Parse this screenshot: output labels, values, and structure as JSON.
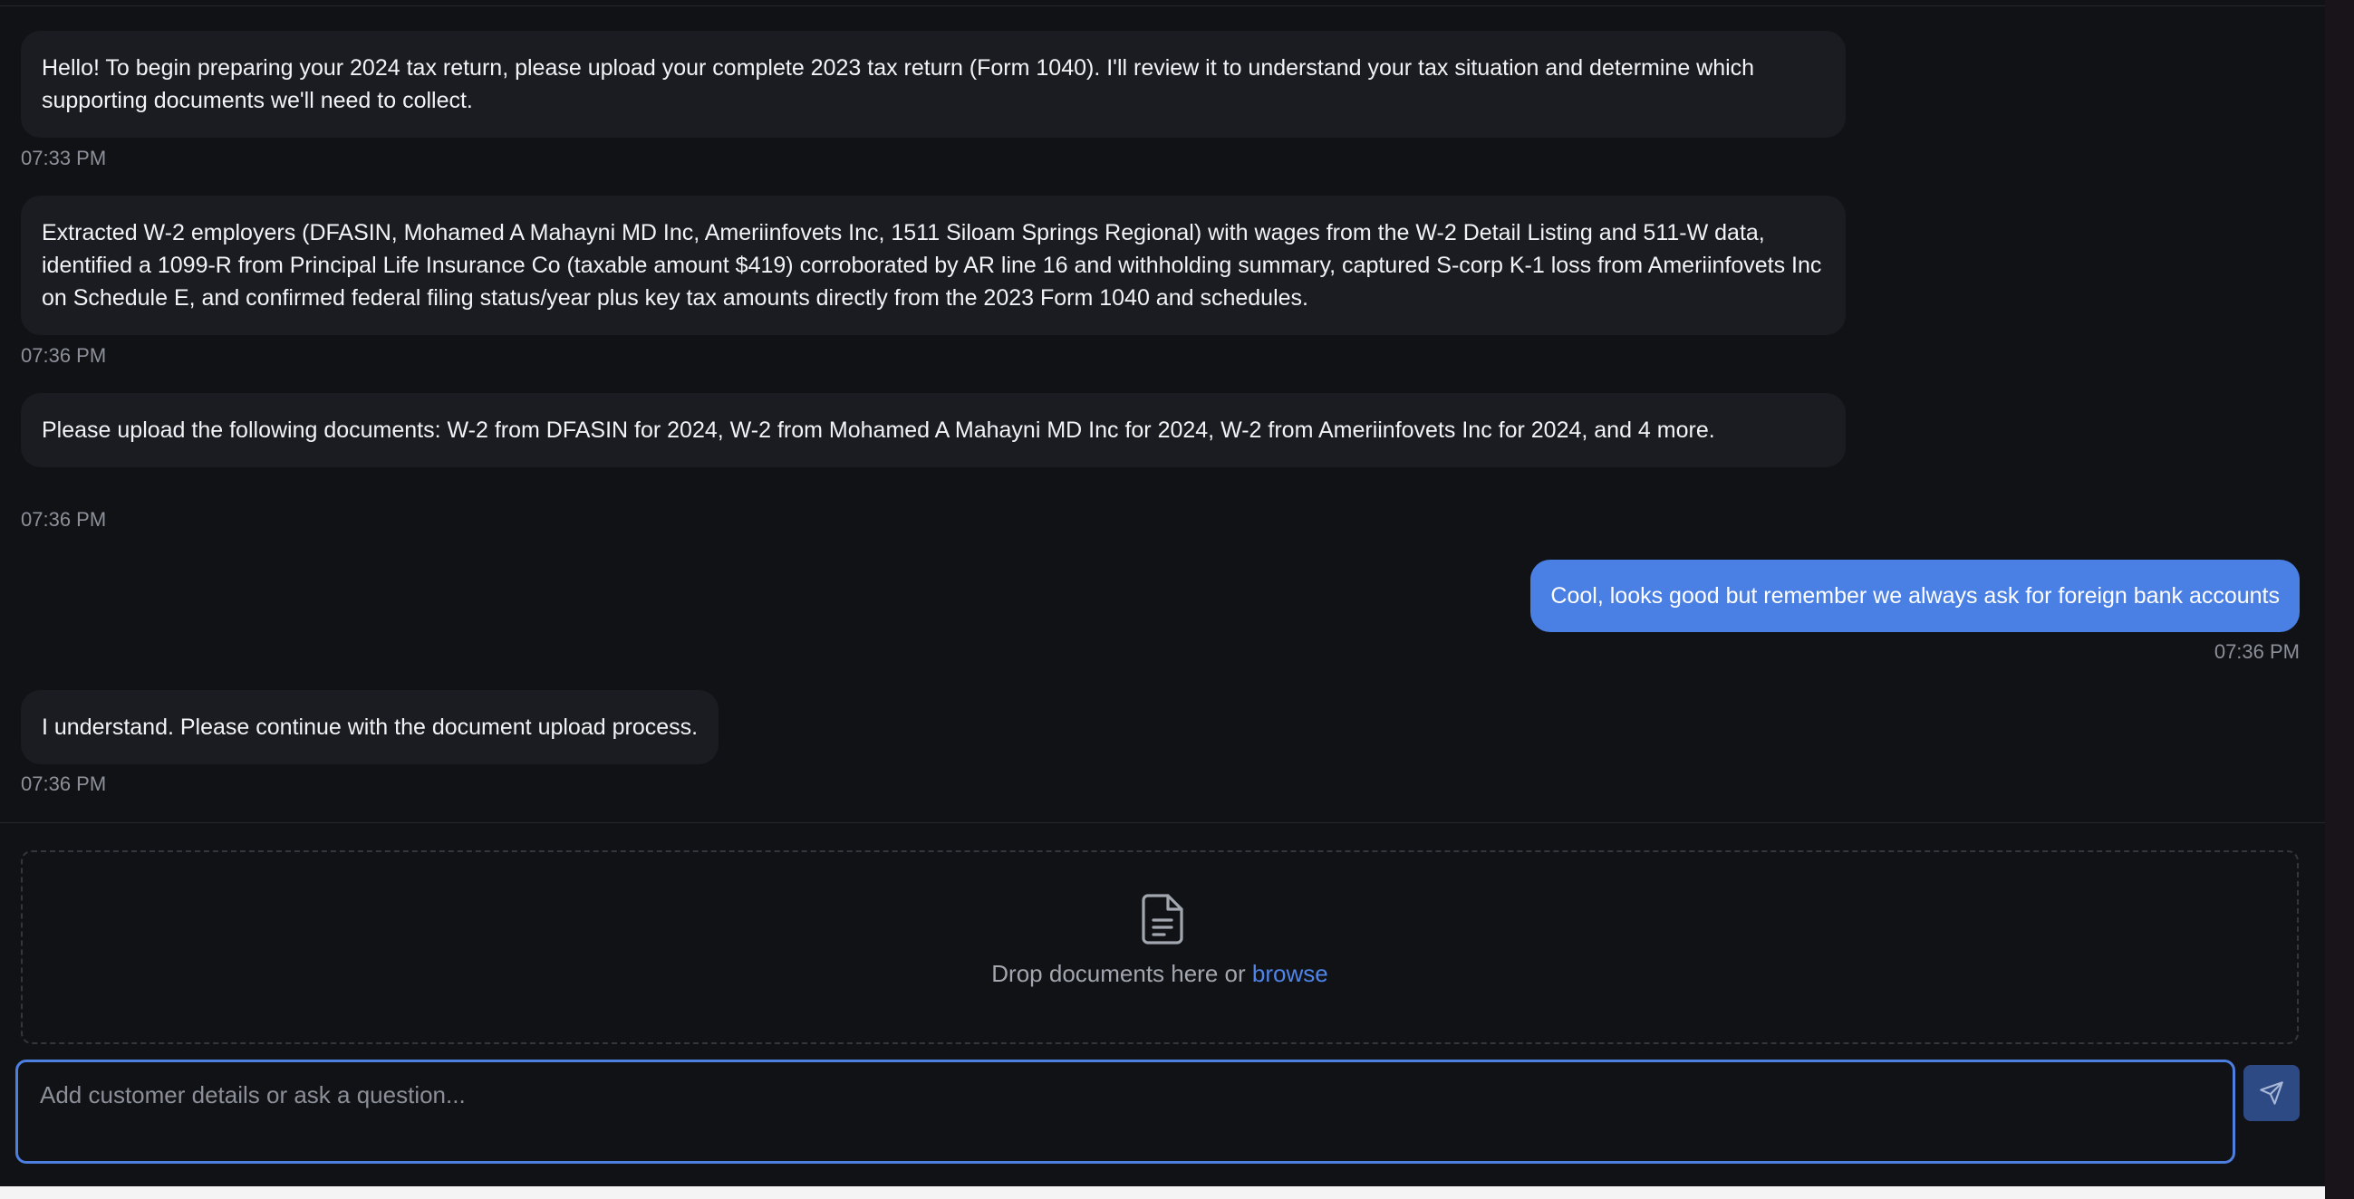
{
  "messages": [
    {
      "role": "assistant",
      "text": "Hello! To begin preparing your 2024 tax return, please upload your complete 2023 tax return (Form 1040). I'll review it to understand your tax situation and determine which supporting documents we'll need to collect.",
      "time": "07:33 PM"
    },
    {
      "role": "assistant",
      "text": "Extracted W-2 employers (DFASIN, Mohamed A Mahayni MD Inc, Ameriinfovets Inc, 1511 Siloam Springs Regional) with wages from the W-2 Detail Listing and 511-W data, identified a 1099-R from Principal Life Insurance Co (taxable amount $419) corroborated by AR line 16 and withholding summary, captured S-corp K-1 loss from Ameriinfovets Inc on Schedule E, and confirmed federal filing status/year plus key tax amounts directly from the 2023 Form 1040 and schedules.",
      "time": "07:36 PM"
    },
    {
      "role": "assistant",
      "text": "Please upload the following documents: W-2 from DFASIN for 2024, W-2 from Mohamed A Mahayni MD Inc for 2024, W-2 from Ameriinfovets Inc for 2024, and 4 more.",
      "time": "07:36 PM"
    },
    {
      "role": "user",
      "text": "Cool, looks good but remember we always ask for foreign bank accounts",
      "time": "07:36 PM"
    },
    {
      "role": "assistant",
      "text": "I understand. Please continue with the document upload process.",
      "time": "07:36 PM"
    }
  ],
  "dropzone": {
    "icon": "document-icon",
    "text": "Drop documents here or ",
    "link": "browse"
  },
  "composer": {
    "placeholder": "Add customer details or ask a question...",
    "value": "",
    "send_icon": "send-icon"
  },
  "colors": {
    "background": "#111216",
    "assistant_bubble": "#1b1c21",
    "user_bubble": "#4a7fe4",
    "accent": "#4f84e8",
    "timestamp": "#8c9099"
  }
}
